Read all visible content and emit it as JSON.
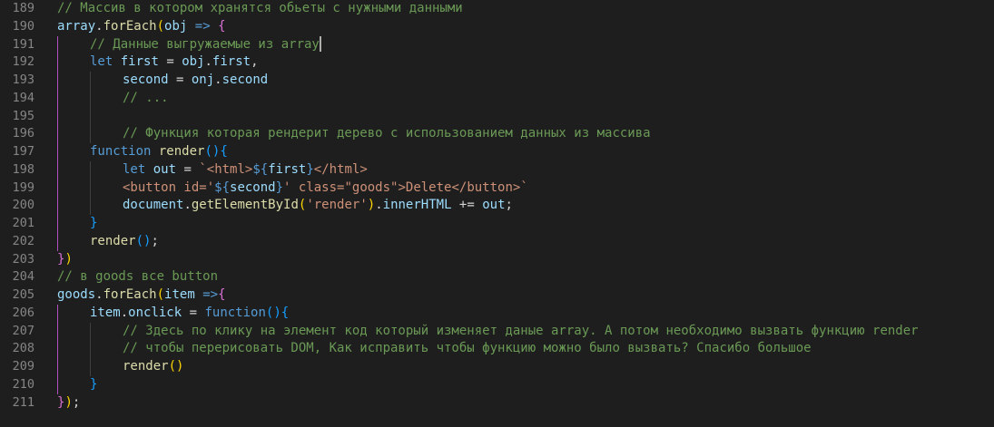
{
  "editor": {
    "lines": [
      {
        "num": "189",
        "indent": 0,
        "tokens": [
          {
            "c": "cm",
            "t": "// Массив в котором хранятся обьеты с нужными данными"
          }
        ]
      },
      {
        "num": "190",
        "indent": 0,
        "tokens": [
          {
            "c": "vr",
            "t": "array"
          },
          {
            "c": "op",
            "t": "."
          },
          {
            "c": "fn",
            "t": "forEach"
          },
          {
            "c": "br1",
            "t": "("
          },
          {
            "c": "vr",
            "t": "obj"
          },
          {
            "c": "op",
            "t": " "
          },
          {
            "c": "kw",
            "t": "=>"
          },
          {
            "c": "op",
            "t": " "
          },
          {
            "c": "br2",
            "t": "{"
          }
        ]
      },
      {
        "num": "191",
        "indent": 1,
        "tokens": [
          {
            "c": "cm",
            "t": "// Данные выгружаемые из array"
          }
        ],
        "cursor": true
      },
      {
        "num": "192",
        "indent": 1,
        "tokens": [
          {
            "c": "kw",
            "t": "let"
          },
          {
            "c": "op",
            "t": " "
          },
          {
            "c": "vr",
            "t": "first"
          },
          {
            "c": "op",
            "t": " = "
          },
          {
            "c": "vr",
            "t": "obj"
          },
          {
            "c": "op",
            "t": "."
          },
          {
            "c": "vr",
            "t": "first"
          },
          {
            "c": "op",
            "t": ","
          }
        ]
      },
      {
        "num": "193",
        "indent": 2,
        "tokens": [
          {
            "c": "vr",
            "t": "second"
          },
          {
            "c": "op",
            "t": " = "
          },
          {
            "c": "vr",
            "t": "onj"
          },
          {
            "c": "op",
            "t": "."
          },
          {
            "c": "vr",
            "t": "second"
          }
        ]
      },
      {
        "num": "194",
        "indent": 2,
        "tokens": [
          {
            "c": "cm",
            "t": "// ..."
          }
        ]
      },
      {
        "num": "195",
        "indent": 2,
        "tokens": []
      },
      {
        "num": "196",
        "indent": 2,
        "tokens": [
          {
            "c": "cm",
            "t": "// Функция которая рендерит дерево с использованием данных из массива"
          }
        ]
      },
      {
        "num": "197",
        "indent": 1,
        "tokens": [
          {
            "c": "kw",
            "t": "function"
          },
          {
            "c": "op",
            "t": " "
          },
          {
            "c": "fn",
            "t": "render"
          },
          {
            "c": "br3",
            "t": "()"
          },
          {
            "c": "br3",
            "t": "{"
          }
        ]
      },
      {
        "num": "198",
        "indent": 2,
        "tokens": [
          {
            "c": "kw",
            "t": "let"
          },
          {
            "c": "op",
            "t": " "
          },
          {
            "c": "vr",
            "t": "out"
          },
          {
            "c": "op",
            "t": " = "
          },
          {
            "c": "str",
            "t": "`<"
          },
          {
            "c": "str",
            "t": "html"
          },
          {
            "c": "str",
            "t": ">"
          },
          {
            "c": "pu",
            "t": "${"
          },
          {
            "c": "vr",
            "t": "first"
          },
          {
            "c": "pu",
            "t": "}"
          },
          {
            "c": "str",
            "t": "</html>"
          }
        ]
      },
      {
        "num": "199",
        "indent": 2,
        "tokens": [
          {
            "c": "str",
            "t": "<button id='"
          },
          {
            "c": "pu",
            "t": "${"
          },
          {
            "c": "vr",
            "t": "second"
          },
          {
            "c": "pu",
            "t": "}"
          },
          {
            "c": "str",
            "t": "' class=\"goods\">Delete</button>`"
          }
        ]
      },
      {
        "num": "200",
        "indent": 2,
        "tokens": [
          {
            "c": "vr",
            "t": "document"
          },
          {
            "c": "op",
            "t": "."
          },
          {
            "c": "fn",
            "t": "getElementById"
          },
          {
            "c": "br1",
            "t": "("
          },
          {
            "c": "str",
            "t": "'render'"
          },
          {
            "c": "br1",
            "t": ")"
          },
          {
            "c": "op",
            "t": "."
          },
          {
            "c": "vr",
            "t": "innerHTML"
          },
          {
            "c": "op",
            "t": " += "
          },
          {
            "c": "vr",
            "t": "out"
          },
          {
            "c": "op",
            "t": ";"
          }
        ]
      },
      {
        "num": "201",
        "indent": 1,
        "tokens": [
          {
            "c": "br3",
            "t": "}"
          }
        ]
      },
      {
        "num": "202",
        "indent": 1,
        "tokens": [
          {
            "c": "fn",
            "t": "render"
          },
          {
            "c": "br3",
            "t": "()"
          },
          {
            "c": "op",
            "t": ";"
          }
        ]
      },
      {
        "num": "203",
        "indent": 0,
        "tokens": [
          {
            "c": "br2",
            "t": "}"
          },
          {
            "c": "br1",
            "t": ")"
          }
        ]
      },
      {
        "num": "204",
        "indent": 0,
        "tokens": [
          {
            "c": "cm",
            "t": "// в goods все button"
          }
        ]
      },
      {
        "num": "205",
        "indent": 0,
        "tokens": [
          {
            "c": "vr",
            "t": "goods"
          },
          {
            "c": "op",
            "t": "."
          },
          {
            "c": "fn",
            "t": "forEach"
          },
          {
            "c": "br1",
            "t": "("
          },
          {
            "c": "vr",
            "t": "item"
          },
          {
            "c": "op",
            "t": " "
          },
          {
            "c": "kw",
            "t": "=>"
          },
          {
            "c": "br2",
            "t": "{"
          }
        ]
      },
      {
        "num": "206",
        "indent": 1,
        "tokens": [
          {
            "c": "vr",
            "t": "item"
          },
          {
            "c": "op",
            "t": "."
          },
          {
            "c": "vr",
            "t": "onclick"
          },
          {
            "c": "op",
            "t": " = "
          },
          {
            "c": "kw",
            "t": "function"
          },
          {
            "c": "br3",
            "t": "()"
          },
          {
            "c": "br3",
            "t": "{"
          }
        ]
      },
      {
        "num": "207",
        "indent": 2,
        "tokens": [
          {
            "c": "cm",
            "t": "// Здесь по клику на элемент код который изменяет даные array. А потом необходимо вызвать функцию render"
          }
        ]
      },
      {
        "num": "208",
        "indent": 2,
        "tokens": [
          {
            "c": "cm",
            "t": "// чтобы перерисовать DOM, Как исправить чтобы функцию можно было вызвать? Спасибо большое"
          }
        ]
      },
      {
        "num": "209",
        "indent": 2,
        "tokens": [
          {
            "c": "fn",
            "t": "render"
          },
          {
            "c": "br1",
            "t": "()"
          }
        ]
      },
      {
        "num": "210",
        "indent": 1,
        "tokens": [
          {
            "c": "br3",
            "t": "}"
          }
        ]
      },
      {
        "num": "211",
        "indent": 0,
        "tokens": [
          {
            "c": "br2",
            "t": "}"
          },
          {
            "c": "br1",
            "t": ")"
          },
          {
            "c": "op",
            "t": ";"
          }
        ]
      }
    ]
  }
}
